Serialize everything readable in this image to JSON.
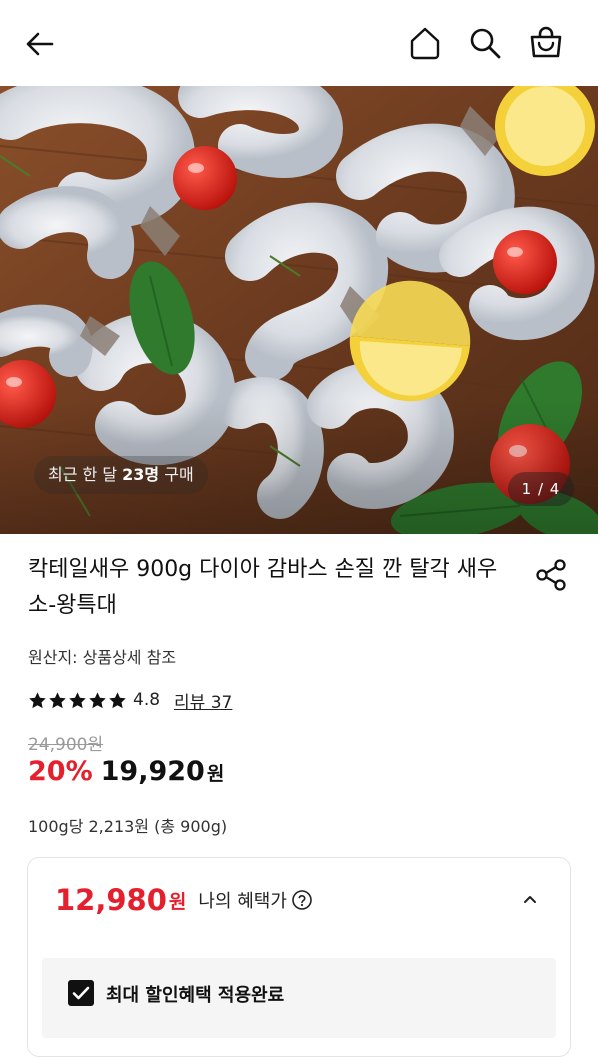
{
  "icons": {
    "back": "back-arrow-icon",
    "home": "home-icon",
    "search": "search-icon",
    "cart": "shopping-bag-icon",
    "share": "share-icon",
    "star": "star-icon",
    "help": "help-circle-icon",
    "chevron": "chevron-up-icon",
    "check": "checkbox-checked-icon"
  },
  "hero": {
    "buyers_prefix": "최근 한 달 ",
    "buyers_count": "23명",
    "buyers_suffix": " 구매",
    "pager": "1 / 4"
  },
  "product": {
    "title": "칵테일새우 900g 다이아 감바스 손질 깐 탈각 새우 소-왕특대",
    "origin": "원산지: 상품상세 참조",
    "rating": {
      "stars": 5,
      "score": "4.8",
      "review_label": "리뷰 37"
    },
    "original_price": "24,900원",
    "discount": "20%",
    "sale_price": "19,920",
    "sale_unit": "원",
    "unit_price": "100g당 2,213원 (총 900g)"
  },
  "benefit": {
    "price": "12,980",
    "unit": "원",
    "label": "나의 혜택가",
    "applied_text": "최대 할인혜택 적용완료"
  },
  "colors": {
    "accent_red": "#e5202e",
    "text": "#111111",
    "muted": "#9a9a9a"
  }
}
